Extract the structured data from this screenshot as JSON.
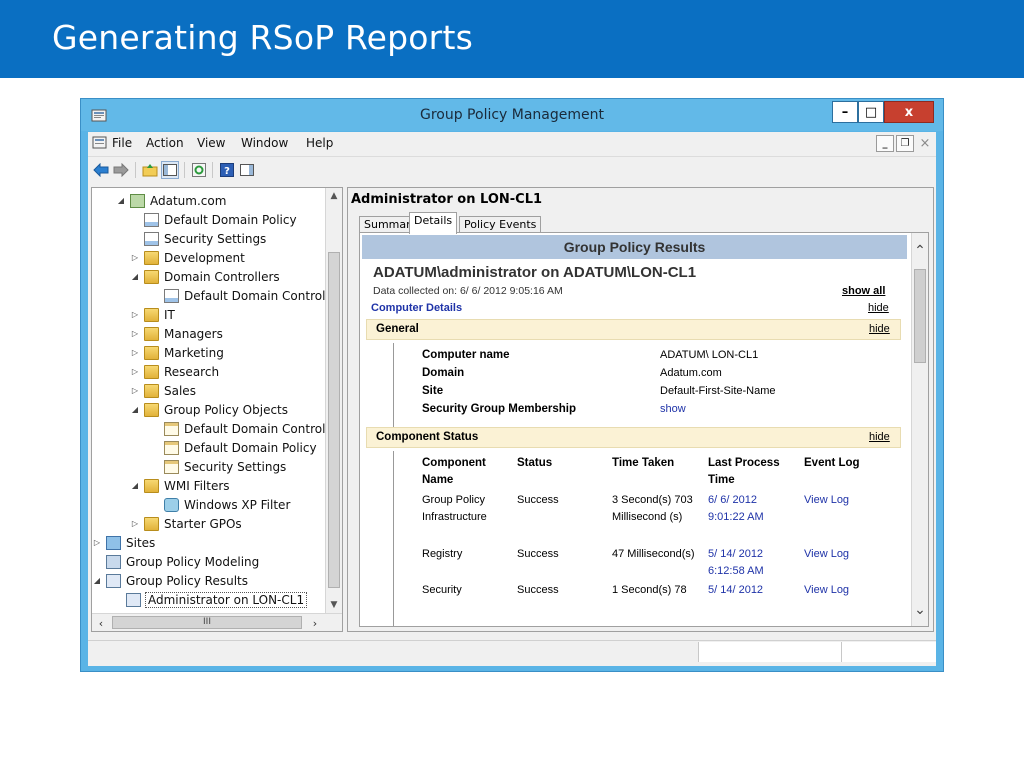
{
  "slide": {
    "title": "Generating RSoP Reports"
  },
  "window": {
    "title": "Group Policy Management",
    "controls": {
      "minimize": "–",
      "maximize": "□",
      "close": "x"
    }
  },
  "menu": {
    "items": [
      "File",
      "Action",
      "View",
      "Window",
      "Help"
    ],
    "mdi": {
      "minimize": "_",
      "restore": "❐",
      "close": "×"
    }
  },
  "toolbar": {
    "icons": [
      "back-icon",
      "forward-icon",
      "up-folder-icon",
      "show-hide-tree-icon",
      "refresh-icon",
      "help-icon",
      "action-pane-icon"
    ]
  },
  "tree": {
    "items": [
      {
        "label": "Adatum.com",
        "expander": "◢",
        "icon": "domain"
      },
      {
        "label": "Default Domain Policy",
        "expander": "",
        "icon": "gpo"
      },
      {
        "label": "Security Settings",
        "expander": "",
        "icon": "gpo"
      },
      {
        "label": "Development",
        "expander": "▷",
        "icon": "folder"
      },
      {
        "label": "Domain Controllers",
        "expander": "◢",
        "icon": "folder"
      },
      {
        "label": "Default Domain Control",
        "expander": "",
        "icon": "gpo"
      },
      {
        "label": "IT",
        "expander": "▷",
        "icon": "folder"
      },
      {
        "label": "Managers",
        "expander": "▷",
        "icon": "folder"
      },
      {
        "label": "Marketing",
        "expander": "▷",
        "icon": "folder"
      },
      {
        "label": "Research",
        "expander": "▷",
        "icon": "folder"
      },
      {
        "label": "Sales",
        "expander": "▷",
        "icon": "folder"
      },
      {
        "label": "Group Policy Objects",
        "expander": "◢",
        "icon": "folder"
      },
      {
        "label": "Default Domain Control",
        "expander": "",
        "icon": "gpodoc"
      },
      {
        "label": "Default Domain Policy",
        "expander": "",
        "icon": "gpodoc"
      },
      {
        "label": "Security Settings",
        "expander": "",
        "icon": "gpodoc"
      },
      {
        "label": "WMI Filters",
        "expander": "◢",
        "icon": "folder"
      },
      {
        "label": "Windows XP Filter",
        "expander": "",
        "icon": "wmi"
      },
      {
        "label": "Starter GPOs",
        "expander": "▷",
        "icon": "folder"
      },
      {
        "label": "Sites",
        "expander": "▷",
        "icon": "sites"
      },
      {
        "label": "Group Policy Modeling",
        "expander": "",
        "icon": "modeling"
      },
      {
        "label": "Group Policy Results",
        "expander": "◢",
        "icon": "results"
      },
      {
        "label": "Administrator on LON-CL1",
        "expander": "",
        "icon": "results"
      }
    ],
    "hscroll_grip": "III"
  },
  "detail": {
    "title": "Administrator on LON-CL1",
    "tabs": [
      "Summary",
      "Details",
      "Policy Events"
    ],
    "active_tab": "Details"
  },
  "report": {
    "header": "Group Policy Results",
    "title": "ADATUM\\administrator on ADATUM\\LON-CL1",
    "collected": "Data collected on: 6/ 6/ 2012 9:05:16 AM",
    "show_all": "show all",
    "computer_details": "Computer Details",
    "hide": "hide",
    "general": {
      "label": "General",
      "rows": [
        {
          "key": "Computer name",
          "value": "ADATUM\\ LON-CL1"
        },
        {
          "key": "Domain",
          "value": "Adatum.com"
        },
        {
          "key": "Site",
          "value": "Default-First-Site-Name"
        },
        {
          "key": "Security Group Membership",
          "value": "show"
        }
      ]
    },
    "component_status": {
      "label": "Component Status",
      "headers": [
        "Component Name",
        "Status",
        "Time Taken",
        "Last Process Time",
        "Event Log"
      ],
      "rows": [
        {
          "name": "Group Policy Infrastructure",
          "status": "Success",
          "time": "3 Second(s) 703 Millisecond (s)",
          "last": "6/ 6/ 2012 9:01:22 AM",
          "log": "View Log"
        },
        {
          "name": "Registry",
          "status": "Success",
          "time": "47 Millisecond(s)",
          "last": "5/ 14/ 2012 6:12:58 AM",
          "log": "View Log"
        },
        {
          "name": "Security",
          "status": "Success",
          "time": "1 Second(s) 78",
          "last": "5/ 14/ 2012",
          "log": "View Log"
        }
      ]
    }
  },
  "colors": {
    "slide_header": "#0a6fc2",
    "titlebar": "#62b9e8",
    "report_header": "#b0c5de",
    "band": "#fbf2d5",
    "link": "#1f33a8"
  }
}
